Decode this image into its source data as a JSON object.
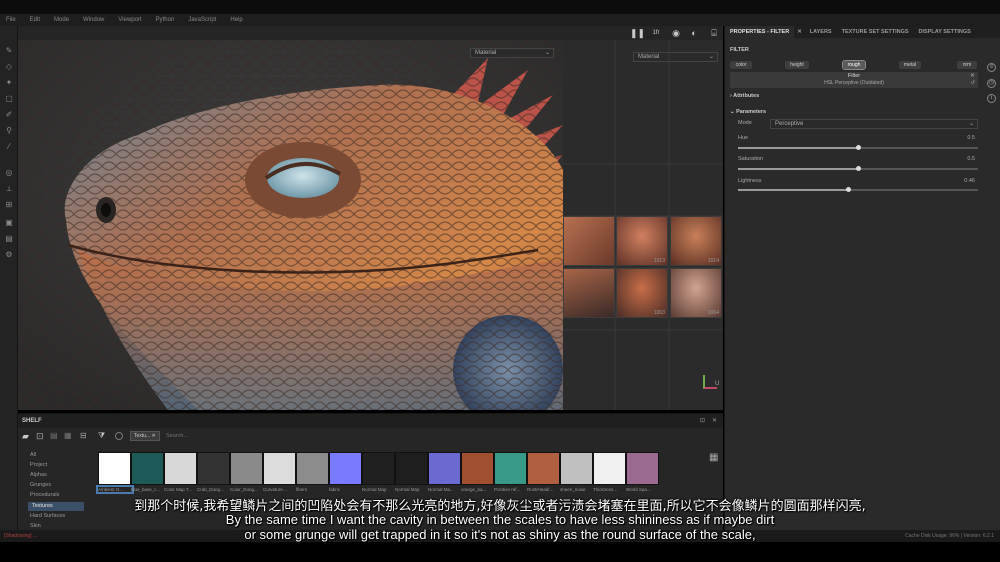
{
  "menu": [
    "File",
    "Edit",
    "Mode",
    "Window",
    "Viewport",
    "Python",
    "JavaScript",
    "Help"
  ],
  "viewport": {
    "material_dropdown_3d": "Material",
    "material_dropdown_2d": "Material",
    "uv_tiles": [
      "1013",
      "1014",
      "1003",
      "1004"
    ],
    "axis_label": "U"
  },
  "panel": {
    "tabs": [
      "PROPERTIES - FILTER",
      "LAYERS",
      "TEXTURE SET SETTINGS",
      "DISPLAY SETTINGS"
    ],
    "section_filter": "FILTER",
    "channels": [
      "color",
      "height",
      "rough",
      "metal",
      "nrm"
    ],
    "active_channel": "rough",
    "filter_title": "Filter",
    "filter_name": "HSL Perceptive (Outdated)",
    "attributes": "Attributes",
    "parameters": "Parameters",
    "mode_label": "Mode",
    "mode_value": "Perceptive",
    "hue_label": "Hue",
    "hue_value": "0.5",
    "saturation_label": "Saturation",
    "saturation_value": "0.5",
    "lightness_label": "Lightness",
    "lightness_value": "0.46"
  },
  "sliders": {
    "hue": 0.5,
    "saturation": 0.5,
    "lightness": 0.46
  },
  "shelf": {
    "title": "SHELF",
    "filter_tag": "Textu...",
    "search_placeholder": "Search...",
    "categories": [
      "All",
      "Project",
      "Alphas",
      "Grunges",
      "Procedurals",
      "Textures",
      "Hard Surfaces",
      "Skin"
    ],
    "selected_category": "Textures",
    "items": [
      "Ambient O...",
      "blue_base_c...",
      "Color Map T...",
      "Crab_Dung...",
      "Color_Dung...",
      "Curvature ...",
      "fibers",
      "fabric",
      "Normal Map",
      "Normal Map",
      "Normal Ma...",
      "orange_ba...",
      "Position ref...",
      "Rust/Head/...",
      "sheen_noise",
      "Thickness...",
      "World Spa..."
    ]
  },
  "status": {
    "left": "[Shadowing] ...",
    "right": "Cache Disk Usage: 96% | Version: 6.2.1"
  },
  "subtitles": {
    "cn": "到那个时候,我希望鳞片之间的凹陷处会有不那么光亮的地方,好像灰尘或者污渍会堵塞在里面,所以它不会像鳞片的圆面那样闪亮,",
    "en1": "By the same time I want the cavity in between the scales to have less shininess as if maybe dirt",
    "en2": "or some grunge will get trapped in it so it's not as shiny as the round surface of the scale,"
  },
  "colors": {
    "accent": "#3b4f67",
    "panel": "#2a2a2a",
    "scales": "#c46a3c"
  }
}
